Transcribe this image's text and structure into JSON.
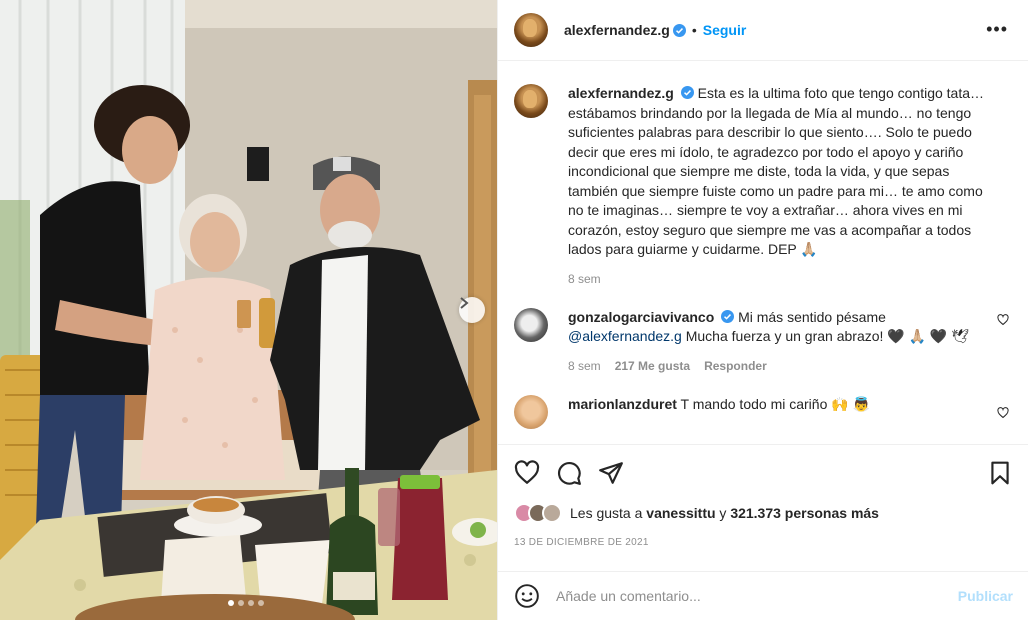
{
  "post": {
    "author": "alexfernandez.g",
    "follow_label": "Seguir",
    "separator": "•",
    "more_label": "•••"
  },
  "caption": {
    "author": "alexfernandez.g",
    "text": "Esta es la ultima foto que tengo contigo tata… estábamos brindando por la llegada de Mía al mundo… no tengo suficientes palabras para describir lo que siento…. Solo te puedo decir que eres mi ídolo, te agradezco por todo el apoyo y cariño incondicional que siempre me diste, toda la vida, y que sepas también que siempre fuiste como un padre para mi… te amo como no te imaginas… siempre te voy a extrañar… ahora vives en mi corazón, estoy seguro que siempre me vas a acompañar a todos lados para guiarme y cuidarme. DEP 🙏🏼",
    "time": "8 sem"
  },
  "comments": [
    {
      "author": "gonzalogarciavivanco",
      "text_before": "Mi más sentido pésame",
      "mention": "@alexfernandez.g",
      "text_after": "Mucha fuerza y un gran abrazo! 🖤 🙏🏼 🖤 🕊",
      "time": "8 sem",
      "likes": "217 Me gusta",
      "reply_label": "Responder"
    },
    {
      "author": "marionlanzduret",
      "text": "T mando todo mi cariño 🙌 👼"
    }
  ],
  "likes": {
    "prefix": "Les gusta a",
    "user": "vanessittu",
    "middle": "y",
    "count": "321.373 personas más"
  },
  "date": "13 DE DICIEMBRE DE 2021",
  "comment_box": {
    "placeholder": "Añade un comentario...",
    "publish_label": "Publicar"
  },
  "carousel": {
    "total": 4,
    "active": 1
  },
  "colors": {
    "accent": "#0095f6",
    "publish_disabled": "#b2dffc",
    "verified": "#3897f0",
    "muted": "#8e8e8e"
  }
}
